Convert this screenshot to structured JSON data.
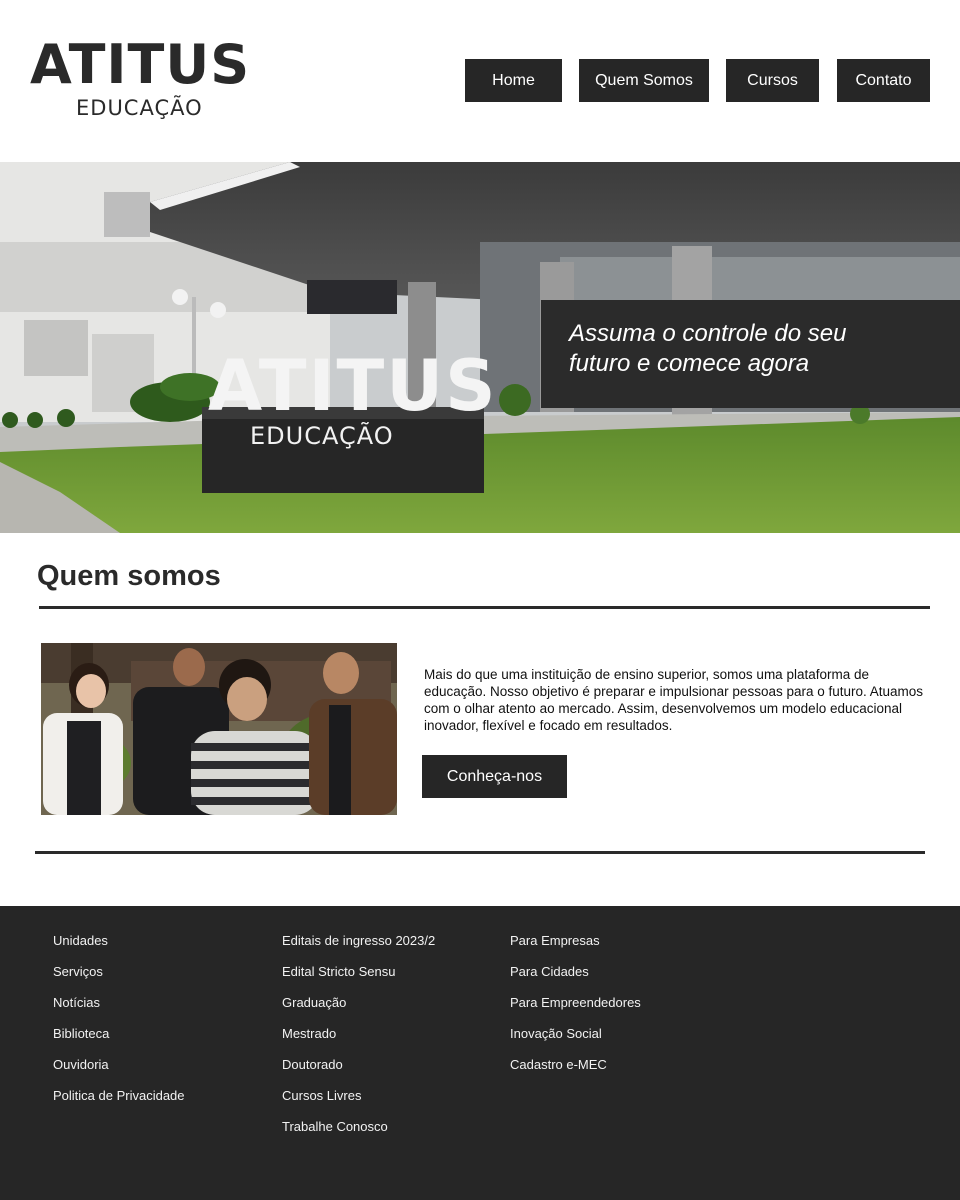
{
  "brand": {
    "name": "ATITUS",
    "subtitle": "EDUCAÇÃO"
  },
  "nav": {
    "items": [
      {
        "label": "Home"
      },
      {
        "label": "Quem Somos"
      },
      {
        "label": "Cursos"
      },
      {
        "label": "Contato"
      }
    ]
  },
  "hero": {
    "headline_line1": "Assuma o controle do seu",
    "headline_line2": "futuro e comece agora",
    "sign_text": "ATITUS",
    "sign_subtext": "EDUCAÇÃO"
  },
  "about": {
    "title": "Quem somos",
    "description": "Mais do que uma instituição de ensino superior, somos uma plataforma de educação. Nosso objetivo é preparar e impulsionar pessoas para o futuro. Atuamos com o olhar atento ao mercado. Assim, desenvolvemos um modelo educacional inovador, flexível e focado em resultados.",
    "button_label": "Conheça-nos"
  },
  "footer": {
    "col1": [
      "Unidades",
      "Serviços",
      "Notícias",
      "Biblioteca",
      "Ouvidoria",
      "Politica de Privacidade"
    ],
    "col2": [
      "Editais de ingresso 2023/2",
      "Edital Stricto Sensu",
      "Graduação",
      "Mestrado",
      "Doutorado",
      "Cursos Livres",
      "Trabalhe Conosco"
    ],
    "col3": [
      "Para Empresas",
      "Para Cidades",
      "Para Empreendedores",
      "Inovação Social",
      "Cadastro e-MEC"
    ]
  },
  "colors": {
    "dark": "#262626",
    "background": "#ffffff",
    "text": "#2a2a2a"
  }
}
